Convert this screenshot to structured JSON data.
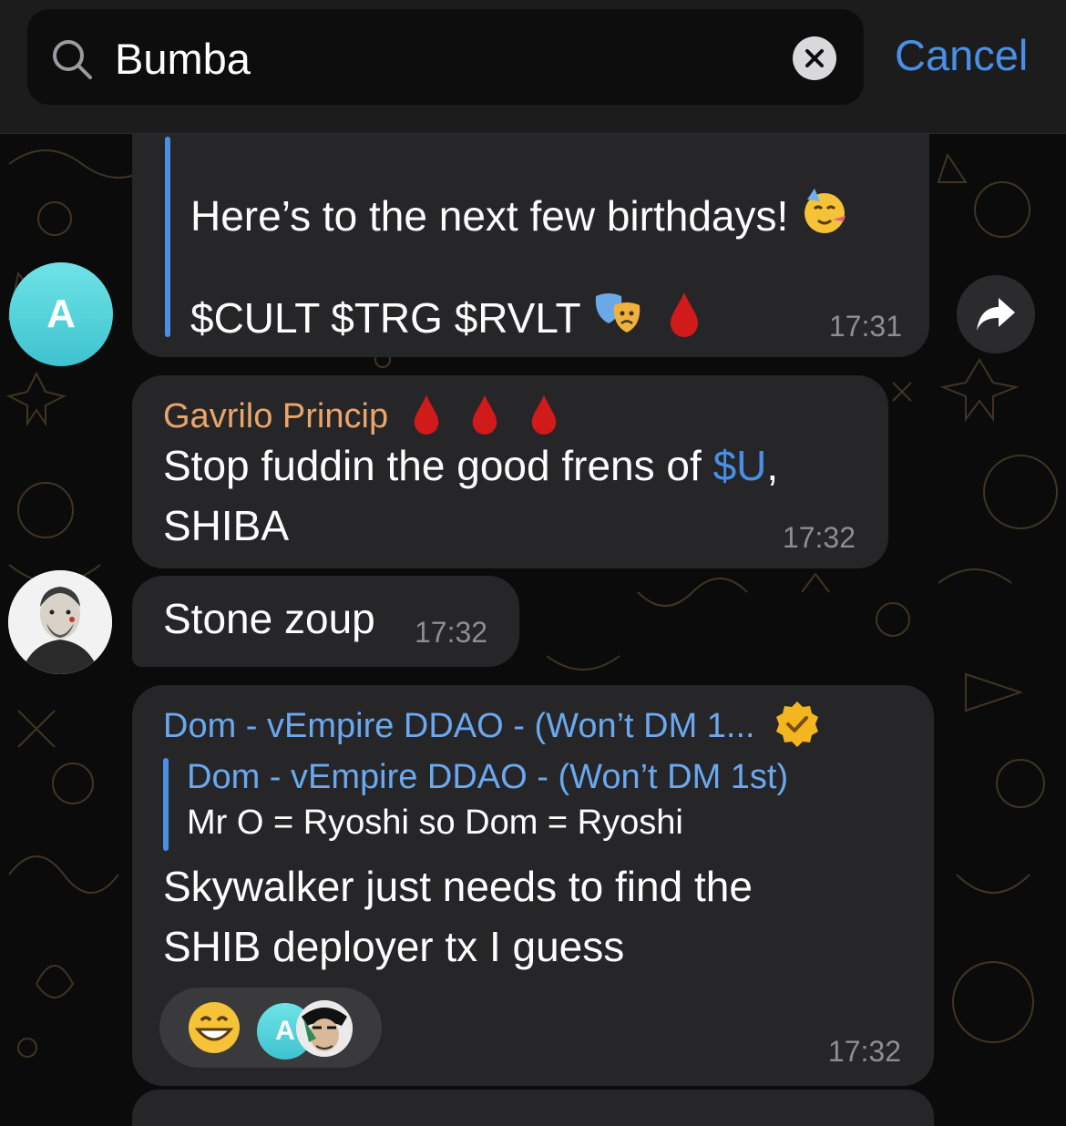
{
  "search": {
    "query": "Bumba",
    "cancel_label": "Cancel"
  },
  "messages": [
    {
      "lines": [
        "Here’s to the next few birthdays!",
        "$CULT $TRG $RVLT"
      ],
      "time": "17:31",
      "avatar_letter": "A"
    },
    {
      "sender": "Gavrilo Princip",
      "text_before": "Stop fuddin the good frens of ",
      "link": "$U",
      "text_after": ",",
      "line2": "SHIBA",
      "time": "17:32"
    },
    {
      "text": "Stone zoup",
      "time": "17:32"
    },
    {
      "sender": "Dom - vEmpire DDAO - (Won’t DM 1...",
      "reply_sender": "Dom - vEmpire DDAO - (Won’t DM 1st)",
      "reply_text": "Mr O = Ryoshi so Dom = Ryoshi",
      "line1": "Skywalker just needs to find the",
      "line2": "SHIB deployer tx I guess",
      "reaction_avatar_letter": "A",
      "time": "17:32"
    }
  ],
  "colors": {
    "accent": "#4a8fe7",
    "sender_orange": "#e9a56b",
    "sender_blue": "#6aa8f0",
    "bubble": "#262628"
  }
}
